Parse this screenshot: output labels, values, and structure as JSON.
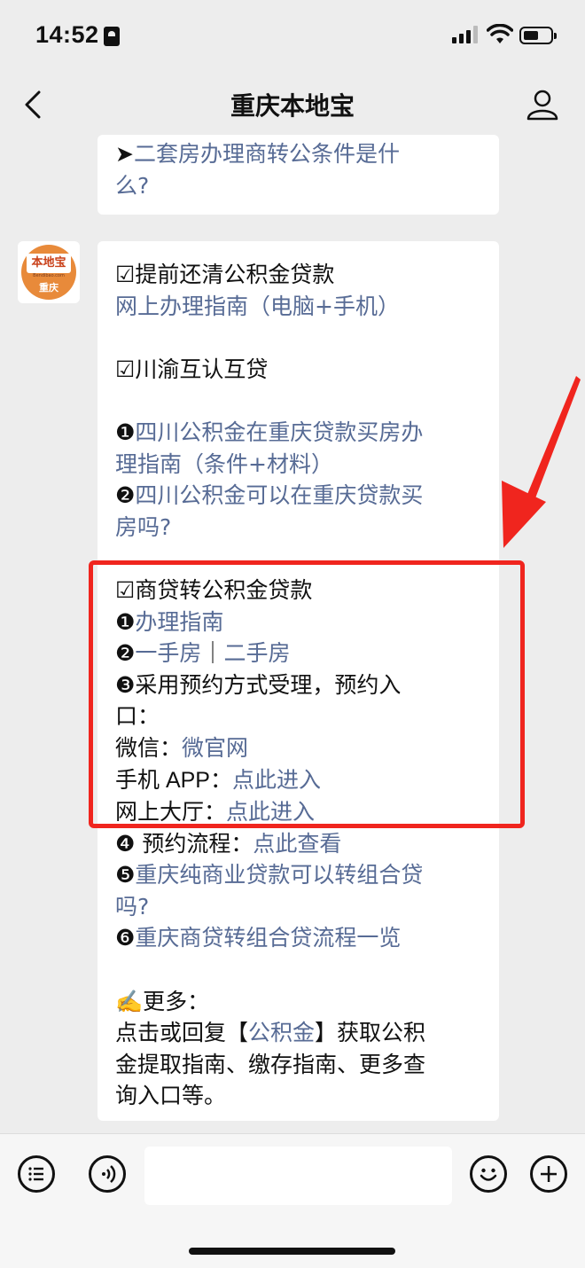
{
  "status_bar": {
    "time": "14:52"
  },
  "header": {
    "title": "重庆本地宝"
  },
  "avatar": {
    "brand": "本地宝",
    "domain": "Bendibao.com",
    "city": "重庆"
  },
  "message_prev": {
    "lines": [
      {
        "prefix": "➤",
        "text": "二套房办理商转公条件是什"
      },
      {
        "prefix": "",
        "text": "么?"
      }
    ]
  },
  "message_main": {
    "prepay_title": "☑提前还清公积金贷款",
    "prepay_link": "网上办理指南（电脑+手机）",
    "sichuan_title": "☑川渝互认互贷",
    "item1_num": "❶",
    "item1_line1": "四川公积金在重庆贷款买房办",
    "item1_line2": "理指南（条件+材料）",
    "item2_num": "❷",
    "item2_line1": "四川公积金可以在重庆贷款买",
    "item2_line2": "房吗?",
    "commercial_title": "☑商贷转公积金贷款",
    "c1_num": "❶",
    "c1_link": "办理指南",
    "c2_num": "❷",
    "c2_link_a": "一手房",
    "c2_sep": "｜",
    "c2_link_b": "二手房",
    "c3_line1": "❸采用预约方式受理，预约入",
    "c3_line2": "口：",
    "wechat_label": "微信：",
    "wechat_link": "微官网",
    "app_label": "手机 APP：",
    "app_link": "点此进入",
    "hall_label": "网上大厅：",
    "hall_link": "点此进入",
    "c4_label": "❹ 预约流程：",
    "c4_link": "点此查看",
    "c5_num": "❺",
    "c5_line1": "重庆纯商业贷款可以转组合贷",
    "c5_line2": "吗?",
    "c6_num": "❻",
    "c6_link": "重庆商贷转组合贷流程一览",
    "more_title": "✍️更多：",
    "more_line1_a": "点击或回复【",
    "more_line1_link": "公积金",
    "more_line1_b": "】获取公积",
    "more_line2": "金提取指南、缴存指南、更多查",
    "more_line3": "询入口等。"
  },
  "colors": {
    "link": "#576b95",
    "highlight": "#f0251e",
    "background": "#ededed"
  },
  "icons": [
    "back-chevron-icon",
    "person-icon",
    "menu-list-icon",
    "voice-icon",
    "emoji-icon",
    "plus-icon",
    "red-arrow-annotation"
  ]
}
